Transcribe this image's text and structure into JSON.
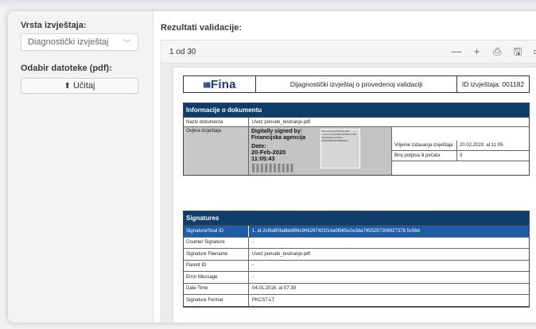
{
  "left": {
    "report_type_label": "Vrsta izvještaja:",
    "report_type_value": "Diagnostički izvještaj",
    "file_label": "Odabir datoteke (pdf):",
    "upload_button": "Učitaj"
  },
  "right": {
    "title": "Rezultati validacije:",
    "page_indicator": "1 od 30",
    "tools": [
      "—",
      "+",
      "⎙",
      "🖫",
      "▭"
    ]
  },
  "doc": {
    "logo": "Fina",
    "header_title": "Dijagnostički izvještaj o provedenoj validaciji",
    "header_id": "ID izvještaja: 001182",
    "info": {
      "heading": "Informacije o dokumentu",
      "name_key": "Naziv dokumenta",
      "name_value": "Uvez ponude_testiranje.pdf",
      "cert_key": "Ovjera izvještaja",
      "signed_by": "Digitally signed by: Financijska agencija",
      "date_label": "Date:",
      "date_value": "20-Feb-2020",
      "time_value": "11:05:43",
      "qr_text": "CN=urn:fina OU=Fina OID 1.3.6.1.4.1.26196 O=FINA C=HR Validacijski certifikat 00000000000000000000",
      "issued_key": "Vrijeme izdavanja izvještaja",
      "issued_value": "20.02.2020. at 11:05",
      "count_key": "Broj potpisa ili pečata",
      "count_value": "3"
    },
    "signatures": {
      "heading": "Signatures",
      "rows": [
        {
          "key": "Signature/Seal ID",
          "value": "1. id-2cf6d80fa8bb996c906267401f14a0fb65e2e3da7455297206927378 5c56d"
        },
        {
          "key": "Counter Signature",
          "value": "-"
        },
        {
          "key": "Signature Filename",
          "value": "Uvez ponude_testiranje.pdf"
        },
        {
          "key": "Parent ID",
          "value": "-"
        },
        {
          "key": "Error Message",
          "value": "-"
        },
        {
          "key": "Date Time",
          "value": "04.01.2016. at 07:39"
        },
        {
          "key": "Signature Format",
          "value": "PKCS7-LT"
        }
      ]
    }
  }
}
